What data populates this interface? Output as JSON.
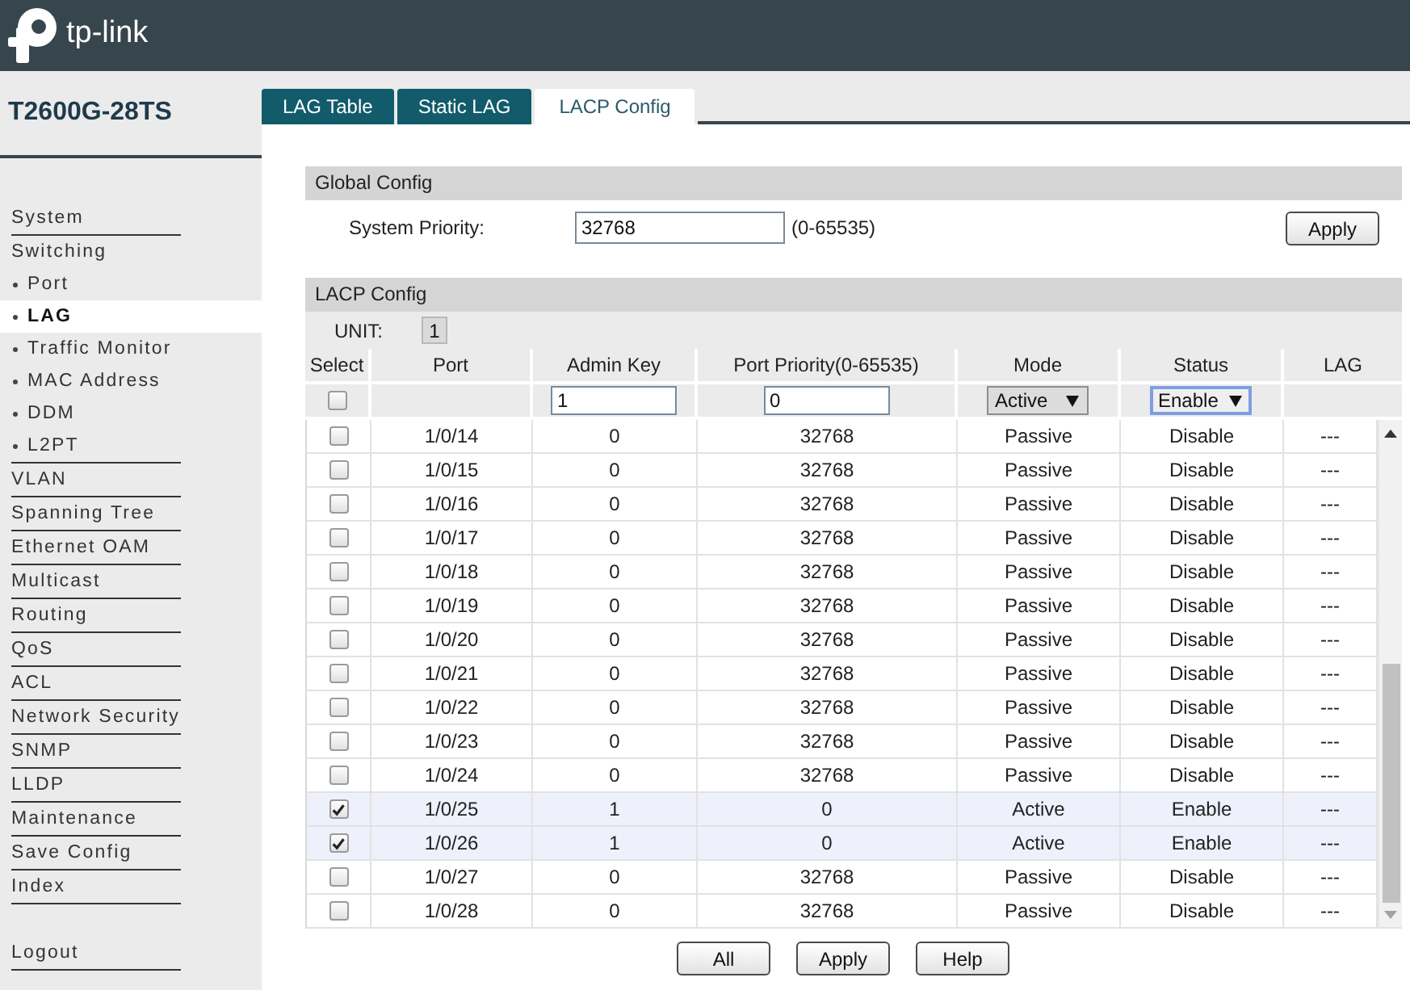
{
  "header": {
    "logo_text": "tp-link"
  },
  "sidebar": {
    "device": "T2600G-28TS",
    "items": [
      {
        "label": "System",
        "selected": false
      },
      {
        "label": "Switching",
        "selected": false,
        "children": [
          {
            "label": "Port",
            "selected": false
          },
          {
            "label": "LAG",
            "selected": true
          },
          {
            "label": "Traffic Monitor",
            "selected": false
          },
          {
            "label": "MAC Address",
            "selected": false
          },
          {
            "label": "DDM",
            "selected": false
          },
          {
            "label": "L2PT",
            "selected": false
          }
        ]
      },
      {
        "label": "VLAN",
        "selected": false
      },
      {
        "label": "Spanning Tree",
        "selected": false
      },
      {
        "label": "Ethernet OAM",
        "selected": false
      },
      {
        "label": "Multicast",
        "selected": false
      },
      {
        "label": "Routing",
        "selected": false
      },
      {
        "label": "QoS",
        "selected": false
      },
      {
        "label": "ACL",
        "selected": false
      },
      {
        "label": "Network Security",
        "selected": false
      },
      {
        "label": "SNMP",
        "selected": false
      },
      {
        "label": "LLDP",
        "selected": false
      },
      {
        "label": "Maintenance",
        "selected": false
      },
      {
        "label": "Save Config",
        "selected": false
      },
      {
        "label": "Index",
        "selected": false
      }
    ],
    "logout": "Logout"
  },
  "tabs": [
    {
      "label": "LAG Table",
      "selected": false
    },
    {
      "label": "Static LAG",
      "selected": false
    },
    {
      "label": "LACP Config",
      "selected": true
    }
  ],
  "global_config": {
    "title": "Global Config",
    "system_priority": {
      "label": "System Priority:",
      "value": "32768",
      "range": "(0-65535)"
    },
    "apply_button": "Apply"
  },
  "lacp_config": {
    "title": "LACP Config",
    "unit": {
      "label": "UNIT:",
      "value": "1"
    },
    "columns": [
      "Select",
      "Port",
      "Admin Key",
      "Port Priority(0-65535)",
      "Mode",
      "Status",
      "LAG"
    ],
    "edit_row": {
      "checked": false,
      "admin_key": "1",
      "port_priority": "0",
      "mode": {
        "value": "Active",
        "focused": false
      },
      "status": {
        "value": "Enable",
        "focused": true
      }
    },
    "rows": [
      {
        "checked": false,
        "port": "1/0/14",
        "admin_key": "0",
        "port_priority": "32768",
        "mode": "Passive",
        "status": "Disable",
        "lag": "---"
      },
      {
        "checked": false,
        "port": "1/0/15",
        "admin_key": "0",
        "port_priority": "32768",
        "mode": "Passive",
        "status": "Disable",
        "lag": "---"
      },
      {
        "checked": false,
        "port": "1/0/16",
        "admin_key": "0",
        "port_priority": "32768",
        "mode": "Passive",
        "status": "Disable",
        "lag": "---"
      },
      {
        "checked": false,
        "port": "1/0/17",
        "admin_key": "0",
        "port_priority": "32768",
        "mode": "Passive",
        "status": "Disable",
        "lag": "---"
      },
      {
        "checked": false,
        "port": "1/0/18",
        "admin_key": "0",
        "port_priority": "32768",
        "mode": "Passive",
        "status": "Disable",
        "lag": "---"
      },
      {
        "checked": false,
        "port": "1/0/19",
        "admin_key": "0",
        "port_priority": "32768",
        "mode": "Passive",
        "status": "Disable",
        "lag": "---"
      },
      {
        "checked": false,
        "port": "1/0/20",
        "admin_key": "0",
        "port_priority": "32768",
        "mode": "Passive",
        "status": "Disable",
        "lag": "---"
      },
      {
        "checked": false,
        "port": "1/0/21",
        "admin_key": "0",
        "port_priority": "32768",
        "mode": "Passive",
        "status": "Disable",
        "lag": "---"
      },
      {
        "checked": false,
        "port": "1/0/22",
        "admin_key": "0",
        "port_priority": "32768",
        "mode": "Passive",
        "status": "Disable",
        "lag": "---"
      },
      {
        "checked": false,
        "port": "1/0/23",
        "admin_key": "0",
        "port_priority": "32768",
        "mode": "Passive",
        "status": "Disable",
        "lag": "---"
      },
      {
        "checked": false,
        "port": "1/0/24",
        "admin_key": "0",
        "port_priority": "32768",
        "mode": "Passive",
        "status": "Disable",
        "lag": "---"
      },
      {
        "checked": true,
        "port": "1/0/25",
        "admin_key": "1",
        "port_priority": "0",
        "mode": "Active",
        "status": "Enable",
        "lag": "---"
      },
      {
        "checked": true,
        "port": "1/0/26",
        "admin_key": "1",
        "port_priority": "0",
        "mode": "Active",
        "status": "Enable",
        "lag": "---"
      },
      {
        "checked": false,
        "port": "1/0/27",
        "admin_key": "0",
        "port_priority": "32768",
        "mode": "Passive",
        "status": "Disable",
        "lag": "---"
      },
      {
        "checked": false,
        "port": "1/0/28",
        "admin_key": "0",
        "port_priority": "32768",
        "mode": "Passive",
        "status": "Disable",
        "lag": "---"
      }
    ]
  },
  "buttons": [
    "All",
    "Apply",
    "Help"
  ]
}
